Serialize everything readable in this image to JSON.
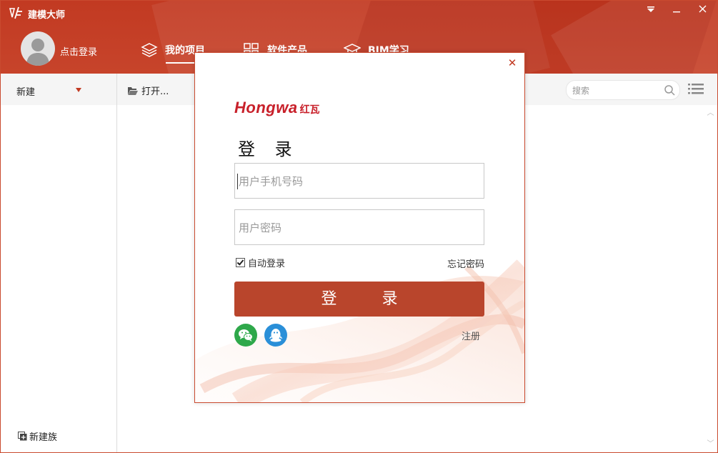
{
  "app": {
    "title": "建模大师",
    "window_controls": [
      "▾",
      "—",
      "✕"
    ]
  },
  "header": {
    "login_link": "点击登录",
    "tabs": [
      {
        "label": "我的项目",
        "active": true
      },
      {
        "label": "软件产品",
        "active": false
      },
      {
        "label": "BIM学习",
        "active": false
      }
    ]
  },
  "left_panel": {
    "new_label": "新建",
    "new_family_label": "新建族"
  },
  "toolbar": {
    "open_label": "打开...",
    "search_placeholder": "搜索"
  },
  "login_dialog": {
    "brand_en": "Hongwa",
    "brand_cn": "红瓦",
    "title": "登 录",
    "phone_placeholder": "用户手机号码",
    "password_placeholder": "用户密码",
    "auto_login_label": "自动登录",
    "auto_login_checked": true,
    "forgot_password": "忘记密码",
    "login_button": "登 录",
    "register": "注册",
    "close": "✕"
  },
  "colors": {
    "brand_red": "#c23a22",
    "button_red": "#b9452c",
    "wechat_green": "#2ea84a",
    "qq_blue": "#2a8fd8"
  }
}
